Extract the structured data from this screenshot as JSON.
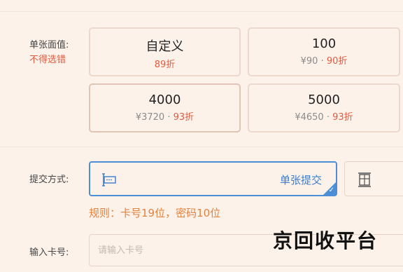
{
  "denomination": {
    "label": "单张面值:",
    "note": "不得选错",
    "options": [
      {
        "main": "自定义",
        "discount": "89折"
      },
      {
        "main": "100",
        "price": "¥90",
        "dot": "·",
        "discount": "90折"
      },
      {
        "main": "4000",
        "price": "¥3720",
        "dot": "·",
        "discount": "93折"
      },
      {
        "main": "5000",
        "price": "¥4650",
        "dot": "·",
        "discount": "93折"
      }
    ]
  },
  "submit": {
    "label": "提交方式:",
    "single_label": "单张提交",
    "rule": "规则：卡号19位，密码10位"
  },
  "card_input": {
    "label": "输入卡号:",
    "placeholder": "请输入卡号"
  },
  "watermark": "京回收平台",
  "colors": {
    "accent": "#e15a3f",
    "blue": "#4c8fd6",
    "orange": "#e1823f"
  }
}
